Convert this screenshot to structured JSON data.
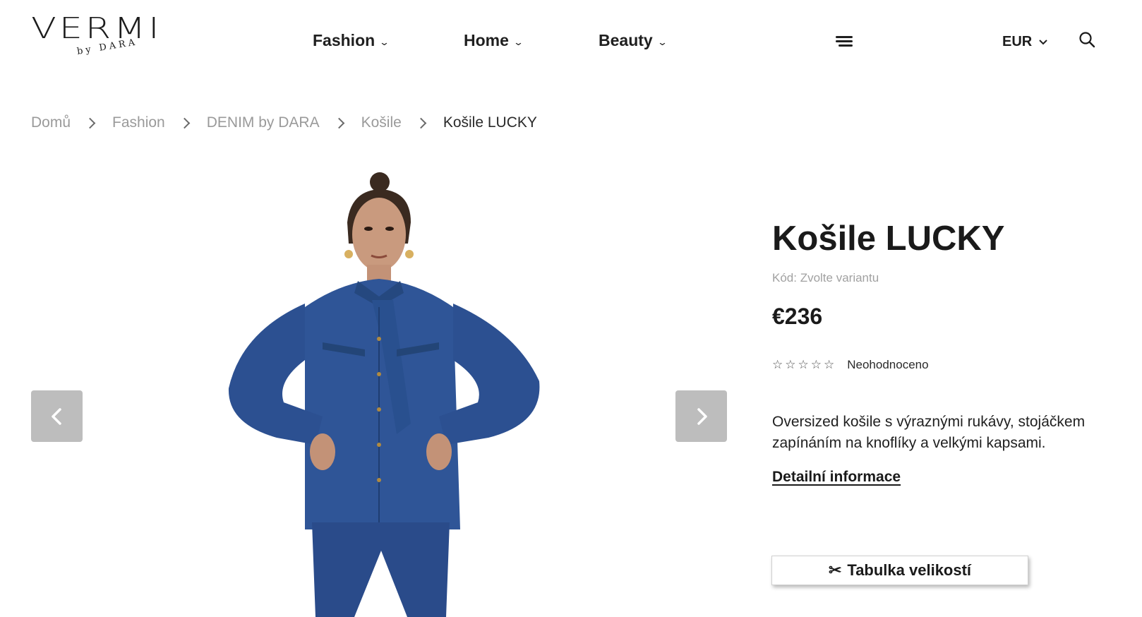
{
  "header": {
    "logo_main": "VERMI",
    "logo_sub": "by DARA",
    "nav": [
      {
        "label": "Fashion"
      },
      {
        "label": "Home"
      },
      {
        "label": "Beauty"
      }
    ],
    "menu_icon": "hamburger-icon",
    "currency": "EUR",
    "search_icon": "search-icon"
  },
  "breadcrumb": [
    {
      "label": "Domů"
    },
    {
      "label": "Fashion"
    },
    {
      "label": "DENIM by DARA"
    },
    {
      "label": "Košile"
    },
    {
      "label": "Košile LUCKY"
    }
  ],
  "gallery": {
    "prev_icon": "chevron-left-icon",
    "next_icon": "chevron-right-icon"
  },
  "product": {
    "title": "Košile LUCKY",
    "code": "Kód: Zvolte variantu",
    "price": "€236",
    "rating_stars": 0,
    "rating_max": 5,
    "rating_label": "Neohodnoceno",
    "description_lines": [
      "Oversized košile s výraznými rukávy, stojáčkem",
      "zapínáním na knoflíky a velkými kapsami."
    ],
    "detail_link": "Detailní informace",
    "size_button": "Tabulka velikostí",
    "size_icon": "scissors-icon"
  },
  "colors": {
    "text": "#1c1c1c",
    "muted": "#9a9a9a",
    "arrow_bg": "#bdbdbd",
    "denim": "#2b4f94"
  }
}
